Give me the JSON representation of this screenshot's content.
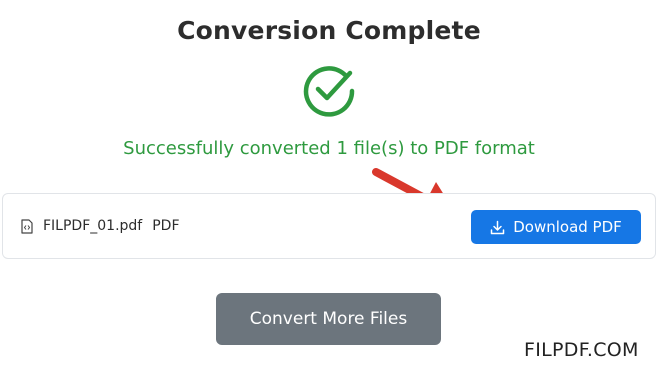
{
  "header": {
    "title": "Conversion Complete"
  },
  "status": {
    "icon": "check-circle-icon",
    "message": "Successfully converted 1 file(s) to PDF format",
    "color": "#2e9a3f"
  },
  "file": {
    "icon": "file-code-icon",
    "name": "FILPDF_01.pdf",
    "type": "PDF"
  },
  "actions": {
    "download_label": "Download PDF",
    "download_icon": "download-icon",
    "download_color": "#1677e5",
    "convert_more_label": "Convert More Files",
    "convert_more_color": "#6c757d"
  },
  "annotation": {
    "arrow_color": "#d9382c"
  },
  "watermark": {
    "text": "FILPDF.COM"
  }
}
